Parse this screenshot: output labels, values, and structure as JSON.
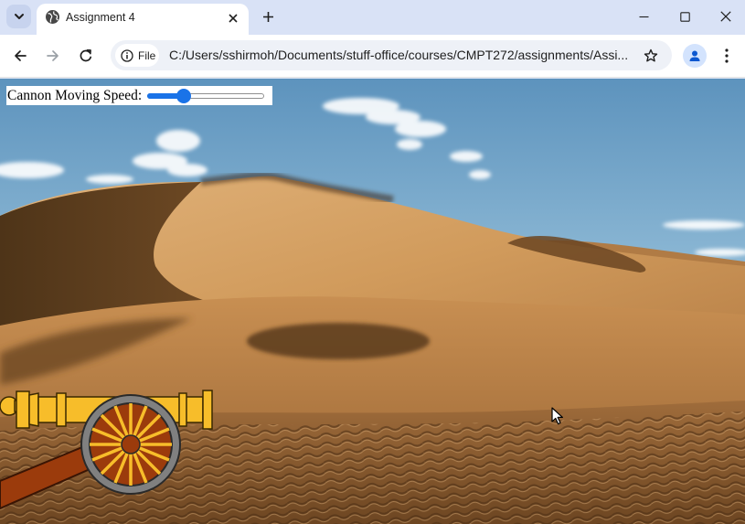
{
  "browser": {
    "tab": {
      "title": "Assignment 4"
    },
    "address": {
      "scheme_label": "File",
      "url": "C:/Users/sshirmoh/Documents/stuff-office/courses/CMPT272/assignments/Assi..."
    },
    "icons": {
      "tab_search": "chevron-down-icon",
      "favicon": "globe-icon",
      "tab_close": "close-icon",
      "new_tab": "plus-icon",
      "minimize": "minimize-icon",
      "maximize": "maximize-icon",
      "close_window": "close-icon",
      "back": "back-arrow-icon",
      "forward": "forward-arrow-icon",
      "reload": "reload-icon",
      "site_info": "info-icon",
      "bookmark": "star-icon",
      "profile": "person-icon",
      "menu": "more-vert-icon"
    }
  },
  "page": {
    "speed_control": {
      "label": "Cannon Moving Speed:",
      "slider_fraction": 0.28
    }
  },
  "colors": {
    "sky_top": "#6a9fc5",
    "sand_light": "#d8a463",
    "sand_shadow": "#5e3f1f",
    "cannon_barrel": "#f7bd2a",
    "cannon_carriage": "#9b3b0c",
    "wheel_rim": "#808080",
    "wheel_spokes": "#9b3b0c",
    "slider_accent": "#1a73e8"
  }
}
